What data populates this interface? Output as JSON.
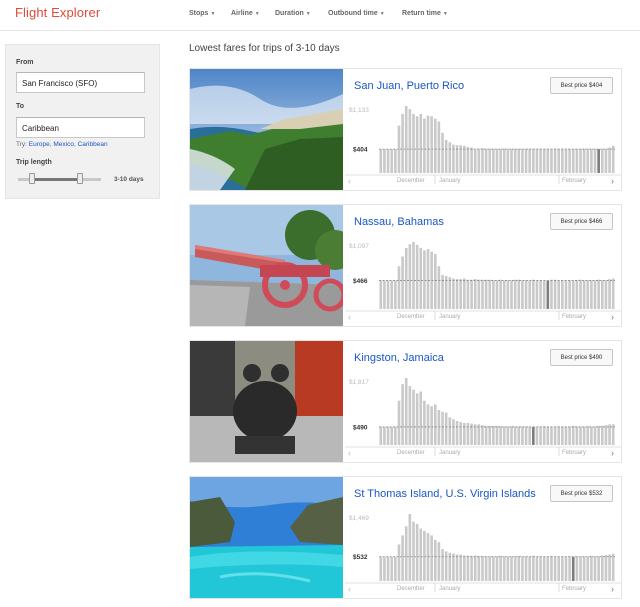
{
  "header": {
    "logo": "Flight Explorer",
    "filters": [
      "Stops",
      "Airline",
      "Duration",
      "Outbound time",
      "Return time"
    ]
  },
  "sidebar": {
    "from_label": "From",
    "from_value": "San Francisco (SFO)",
    "to_label": "To",
    "to_value": "Caribbean",
    "try_prefix": "Try:",
    "try_links": [
      "Europe",
      "Mexico",
      "Caribbean"
    ],
    "trip_length_label": "Trip length",
    "trip_length_value": "3-10 days"
  },
  "main": {
    "heading": "Lowest fares for trips of 3-10 days",
    "chart_months": [
      "December",
      "January",
      "February"
    ],
    "nav_prev": "‹",
    "nav_next": "›",
    "results": [
      {
        "destination": "San Juan, Puerto Rico",
        "best_price": "Best price $404",
        "y_max_label": "$1,133",
        "y_ref_label": "$404"
      },
      {
        "destination": "Nassau, Bahamas",
        "best_price": "Best price $466",
        "y_max_label": "$1,097",
        "y_ref_label": "$466"
      },
      {
        "destination": "Kingston, Jamaica",
        "best_price": "Best price $490",
        "y_max_label": "$1,817",
        "y_ref_label": "$490"
      },
      {
        "destination": "St Thomas Island, U.S. Virgin Islands",
        "best_price": "Best price $532",
        "y_max_label": "$1,469",
        "y_ref_label": "$532"
      }
    ]
  },
  "chart_data": [
    {
      "type": "bar",
      "title": "San Juan, Puerto Rico",
      "ylim": [
        0,
        1133
      ],
      "reference_line": 404,
      "highlight_index": 60,
      "values": [
        404,
        404,
        404,
        404,
        404,
        800,
        1000,
        1133,
        1080,
        1000,
        960,
        1000,
        920,
        970,
        960,
        920,
        870,
        680,
        560,
        520,
        480,
        470,
        470,
        460,
        440,
        430,
        410,
        410,
        420,
        410,
        410,
        410,
        410,
        410,
        415,
        410,
        410,
        410,
        410,
        410,
        410,
        410,
        410,
        410,
        410,
        410,
        410,
        410,
        415,
        410,
        410,
        410,
        410,
        410,
        410,
        410,
        410,
        410,
        410,
        410,
        404,
        410,
        410,
        430,
        460
      ]
    },
    {
      "type": "bar",
      "title": "Nassau, Bahamas",
      "ylim": [
        0,
        1097
      ],
      "reference_line": 466,
      "highlight_index": 46,
      "values": [
        466,
        466,
        466,
        466,
        466,
        700,
        860,
        1000,
        1060,
        1097,
        1050,
        1000,
        960,
        980,
        940,
        900,
        700,
        560,
        540,
        520,
        500,
        490,
        490,
        500,
        480,
        480,
        490,
        480,
        480,
        480,
        480,
        470,
        470,
        480,
        470,
        470,
        470,
        480,
        480,
        470,
        470,
        470,
        480,
        470,
        470,
        470,
        466,
        480,
        480,
        470,
        470,
        470,
        470,
        470,
        470,
        480,
        470,
        470,
        470,
        470,
        480,
        470,
        470,
        490,
        500
      ]
    },
    {
      "type": "bar",
      "title": "Kingston, Jamaica",
      "ylim": [
        0,
        1817
      ],
      "reference_line": 490,
      "highlight_index": 42,
      "values": [
        490,
        490,
        490,
        490,
        490,
        1200,
        1650,
        1817,
        1600,
        1500,
        1400,
        1450,
        1200,
        1100,
        1050,
        1100,
        950,
        900,
        880,
        750,
        700,
        650,
        620,
        600,
        600,
        580,
        560,
        560,
        540,
        520,
        520,
        520,
        520,
        510,
        500,
        500,
        510,
        500,
        500,
        500,
        500,
        500,
        490,
        500,
        500,
        510,
        500,
        500,
        500,
        510,
        500,
        500,
        500,
        520,
        500,
        500,
        500,
        510,
        500,
        500,
        520,
        520,
        540,
        560,
        560
      ]
    },
    {
      "type": "bar",
      "title": "St Thomas Island, U.S. Virgin Islands",
      "ylim": [
        0,
        1469
      ],
      "reference_line": 532,
      "highlight_index": 53,
      "values": [
        532,
        532,
        532,
        532,
        532,
        800,
        1000,
        1200,
        1469,
        1300,
        1250,
        1150,
        1100,
        1050,
        1000,
        900,
        850,
        700,
        650,
        620,
        600,
        580,
        580,
        560,
        560,
        550,
        560,
        550,
        550,
        540,
        540,
        540,
        540,
        550,
        540,
        540,
        540,
        540,
        550,
        540,
        540,
        540,
        550,
        540,
        540,
        540,
        540,
        550,
        540,
        540,
        540,
        540,
        540,
        532,
        540,
        540,
        540,
        540,
        550,
        540,
        540,
        560,
        570,
        580,
        600
      ]
    }
  ]
}
